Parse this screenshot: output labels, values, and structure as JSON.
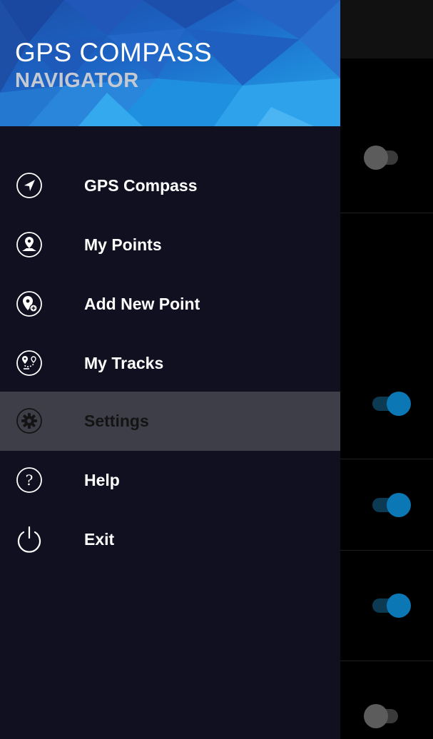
{
  "header": {
    "title": "GPS COMPASS",
    "subtitle": "NAVIGATOR"
  },
  "menu": {
    "items": [
      {
        "label": "GPS Compass",
        "icon": "navigation-arrow-icon"
      },
      {
        "label": "My Points",
        "icon": "map-pin-icon"
      },
      {
        "label": "Add New Point",
        "icon": "add-pin-icon"
      },
      {
        "label": "My Tracks",
        "icon": "route-icon"
      },
      {
        "label": "Settings",
        "icon": "gear-icon",
        "active": true
      },
      {
        "label": "Help",
        "icon": "help-icon"
      },
      {
        "label": "Exit",
        "icon": "power-icon"
      }
    ]
  },
  "background_settings": {
    "toggles": [
      false,
      true,
      true,
      true,
      false
    ]
  },
  "colors": {
    "drawer_bg": "#111020",
    "active_item_bg": "#3e3e49",
    "toggle_on": "#0b78b5",
    "toggle_off": "#5c5c5c"
  }
}
